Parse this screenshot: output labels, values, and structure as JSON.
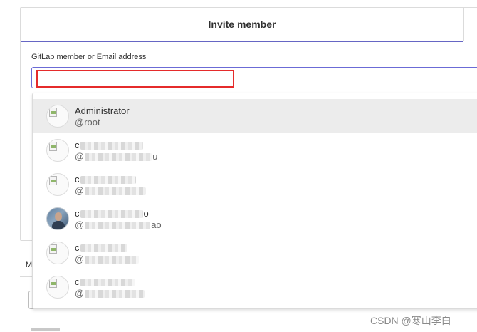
{
  "modal": {
    "tab_title": "Invite member",
    "field_label": "GitLab member or Email address",
    "input_value": ""
  },
  "dropdown": {
    "users": [
      {
        "name": "Administrator",
        "handle": "@root",
        "avatar": "broken-image-icon",
        "name_visible": "Administrator",
        "handle_visible": "@root"
      },
      {
        "name": "c",
        "handle": "@",
        "avatar": "broken-image-icon",
        "name_visible": "c",
        "handle_visible": "@",
        "handle_suffix": "u"
      },
      {
        "name": "c",
        "handle": "@",
        "avatar": "broken-image-icon",
        "name_visible": "c",
        "handle_visible": "@",
        "handle_suffix": ""
      },
      {
        "name": "c",
        "handle": "@",
        "avatar": "user-photo-icon",
        "name_visible": "c",
        "name_suffix": "o",
        "handle_visible": "@",
        "handle_suffix": "ao"
      },
      {
        "name": "c",
        "handle": "@",
        "avatar": "broken-image-icon",
        "name_visible": "c",
        "handle_visible": "@",
        "handle_suffix": ""
      },
      {
        "name": "c",
        "handle": "@",
        "avatar": "broken-image-icon",
        "name_visible": "c",
        "handle_visible": "@",
        "handle_suffix": ""
      }
    ]
  },
  "background": {
    "tab_fragment": "M"
  },
  "watermark": "CSDN @寒山李白",
  "colors": {
    "accent": "#6666c4",
    "highlight": "#e52b2b",
    "active_row": "#ececec"
  }
}
